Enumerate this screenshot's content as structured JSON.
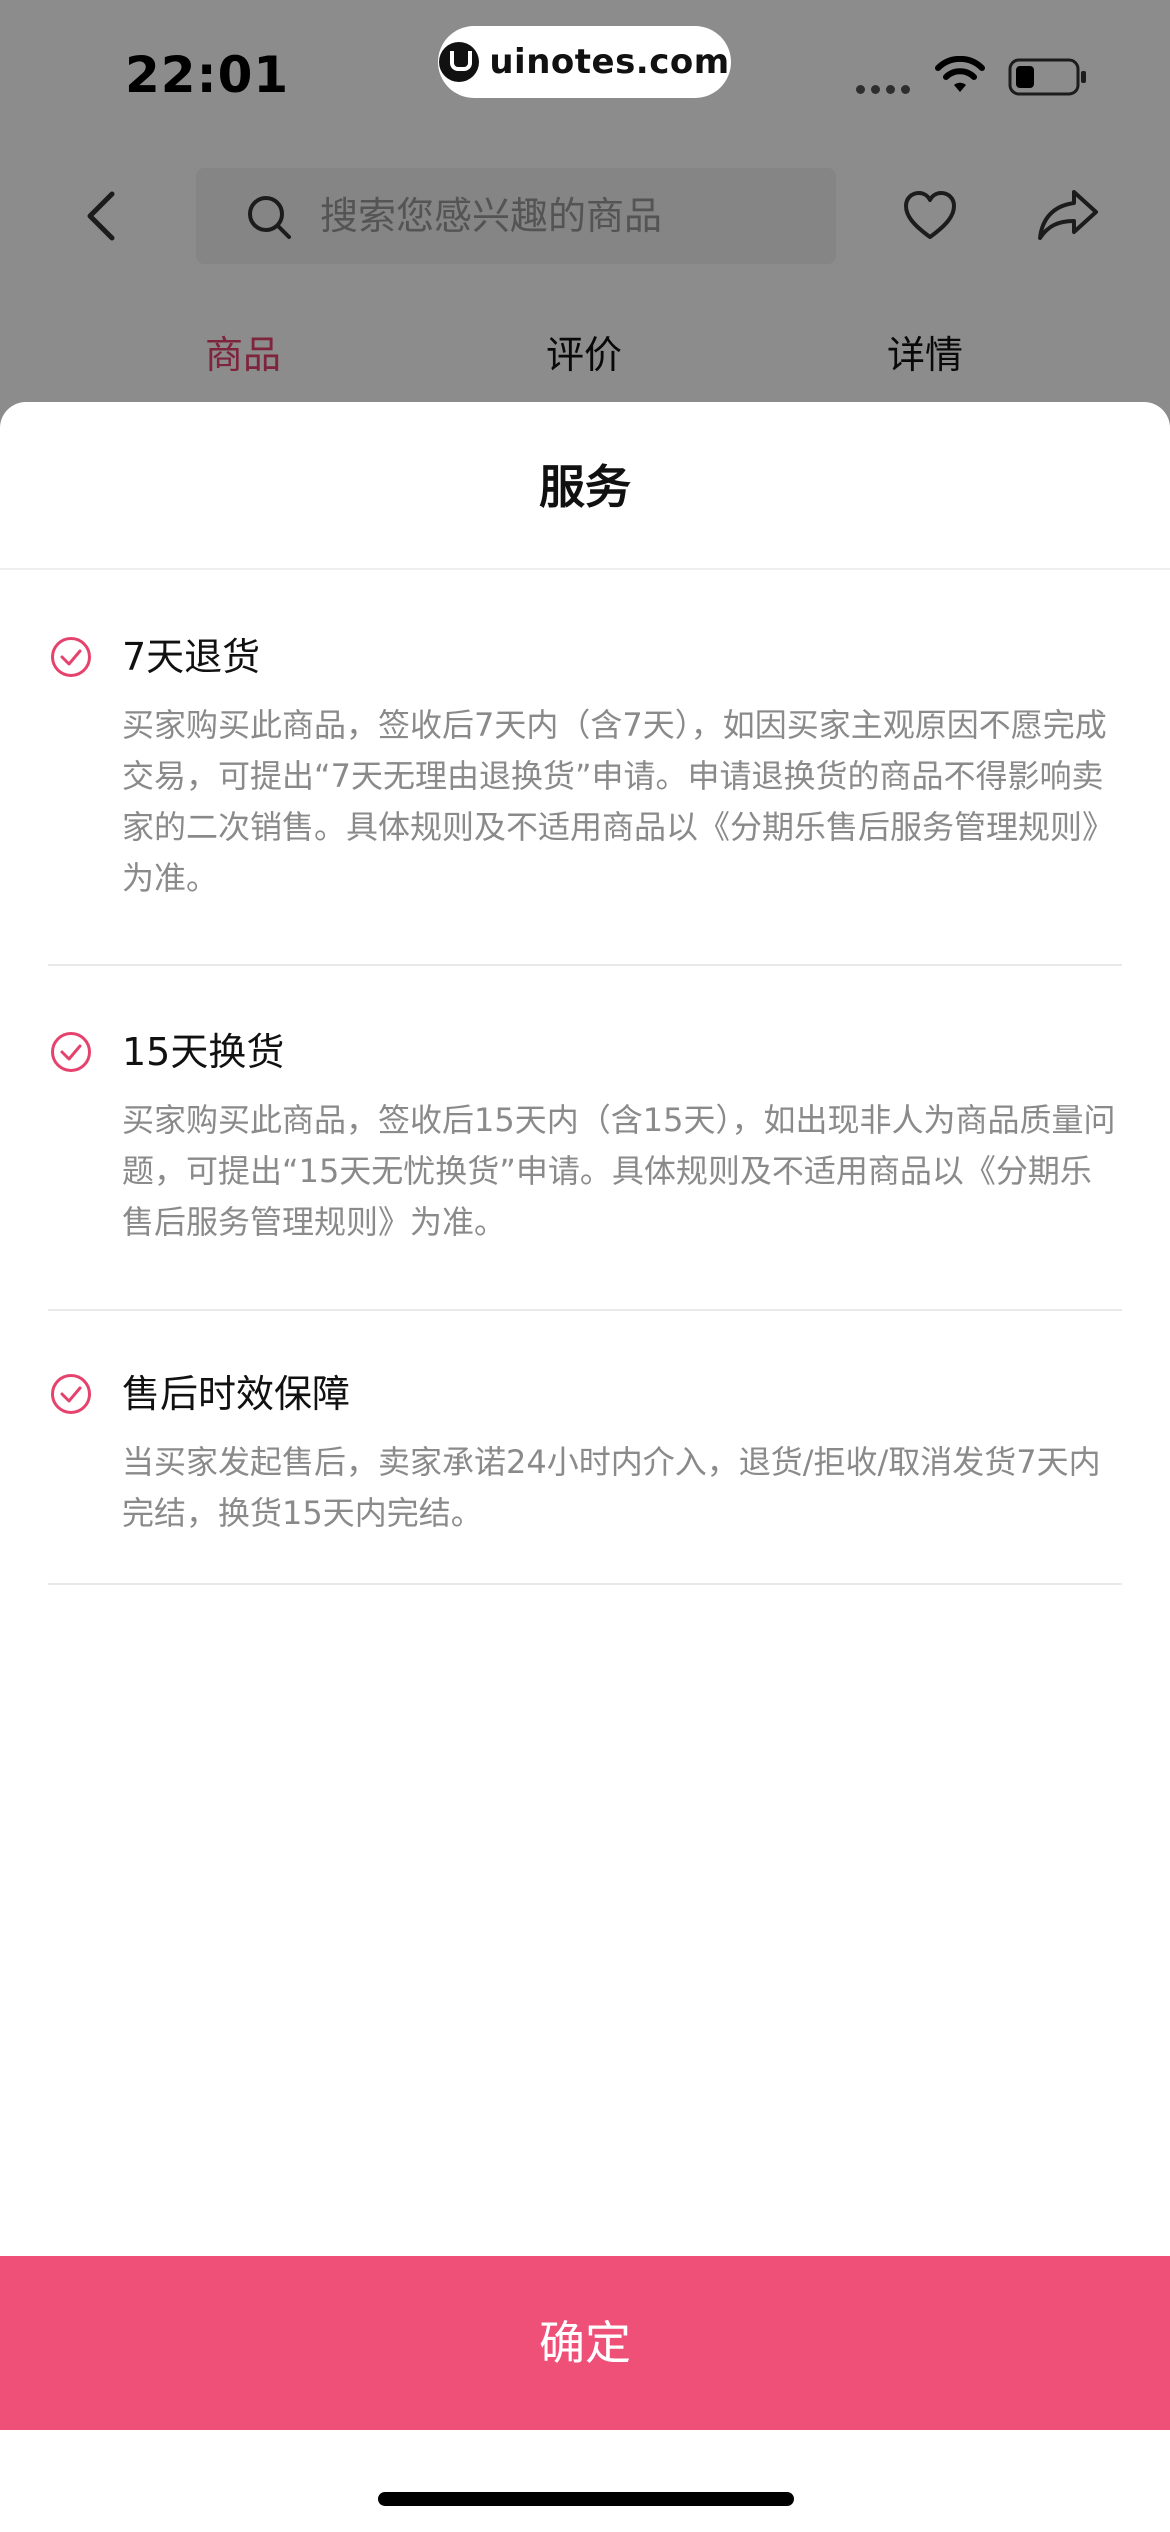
{
  "status_bar": {
    "time": "22:01",
    "watermark": "uinotes.com"
  },
  "header": {
    "search_placeholder": "搜索您感兴趣的商品",
    "icons": {
      "back": "chevron-left-icon",
      "search": "search-icon",
      "favorite": "heart-icon",
      "share": "share-arrow-icon"
    }
  },
  "tabs": [
    {
      "label": "商品",
      "active": true
    },
    {
      "label": "评价",
      "active": false
    },
    {
      "label": "详情",
      "active": false
    }
  ],
  "sheet": {
    "title": "服务",
    "items": [
      {
        "title": "7天退货",
        "description": "买家购买此商品，签收后7天内（含7天），如因买家主观原因不愿完成交易，可提出“7天无理由退换货”申请。申请退换货的商品不得影响卖家的二次销售。具体规则及不适用商品以《分期乐售后服务管理规则》为准。"
      },
      {
        "title": "15天换货",
        "description": "买家购买此商品，签收后15天内（含15天），如出现非人为商品质量问题，可提出“15天无忧换货”申请。具体规则及不适用商品以《分期乐售后服务管理规则》为准。"
      },
      {
        "title": "售后时效保障",
        "description": "当买家发起售后，卖家承诺24小时内介入，退货/拒收/取消发货7天内完结，换货15天内完结。"
      }
    ],
    "confirm_label": "确定"
  },
  "colors": {
    "accent": "#ee5078",
    "active_tab": "#e5436d",
    "check_icon": "#e5436d",
    "description_text": "#8a8a8a",
    "overlay": "rgba(0,0,0,0.45)"
  }
}
